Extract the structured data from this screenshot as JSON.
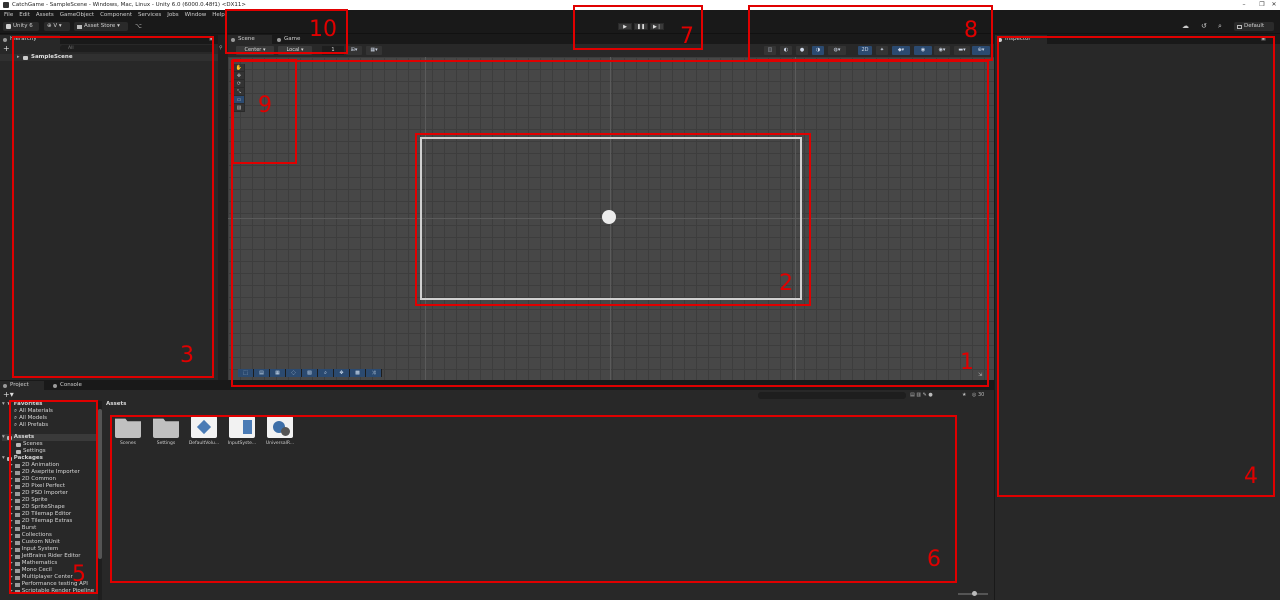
{
  "window": {
    "title": "CatchGame - SampleScene - Windows, Mac, Linux - Unity 6.0 (6000.0.48f1) <DX11>",
    "controls": [
      "–",
      "❐",
      "✕"
    ]
  },
  "menu": [
    "File",
    "Edit",
    "Assets",
    "GameObject",
    "Component",
    "Services",
    "Jobs",
    "Window",
    "Help"
  ],
  "toolbar": {
    "unity_version": "Unity 6",
    "account_label": "⊕ V ▾",
    "asset_store": "Asset Store ▾",
    "layout": "Default",
    "play_icons": [
      "▶",
      "❚❚",
      "▶❘"
    ]
  },
  "hierarchy": {
    "tab": "Hierarchy",
    "search_placeholder": "All",
    "scene": "SampleScene"
  },
  "scene_view": {
    "tabs": [
      "Scene",
      "Game"
    ],
    "pivot": "Center",
    "space": "Local",
    "grid_value": "1"
  },
  "inspector": {
    "tab": "Inspector"
  },
  "project": {
    "tabs": [
      "Project",
      "Console"
    ],
    "breadcrumb": "Assets",
    "search_count": "30",
    "favorites_label": "Favorites",
    "favorites": [
      "All Materials",
      "All Models",
      "All Prefabs"
    ],
    "assets_label": "Assets",
    "asset_folders": [
      "Scenes",
      "Settings"
    ],
    "packages_label": "Packages",
    "packages": [
      "2D Animation",
      "2D Aseprite Importer",
      "2D Common",
      "2D Pixel Perfect",
      "2D PSD Importer",
      "2D Sprite",
      "2D SpriteShape",
      "2D Tilemap Editor",
      "2D Tilemap Extras",
      "Burst",
      "Collections",
      "Custom NUnit",
      "Input System",
      "JetBrains Rider Editor",
      "Mathematics",
      "Mono Cecil",
      "Multiplayer Center",
      "Performance testing API",
      "Scriptable Render Pipeline"
    ],
    "grid_items": [
      {
        "label": "Scenes",
        "icon": "folder-icon"
      },
      {
        "label": "Settings",
        "icon": "folder-icon"
      },
      {
        "label": "DefaultVolu...",
        "icon": "volume-profile-icon"
      },
      {
        "label": "InputSyste...",
        "icon": "input-actions-icon"
      },
      {
        "label": "UniversalR...",
        "icon": "render-pipeline-icon"
      }
    ]
  },
  "annotations": [
    "1",
    "2",
    "3",
    "4",
    "5",
    "6",
    "7",
    "8",
    "9",
    "10"
  ],
  "colors": {
    "annotation": "#e00000",
    "accent_blue": "#2b4a70",
    "panel": "#282828",
    "scene": "#474747"
  }
}
